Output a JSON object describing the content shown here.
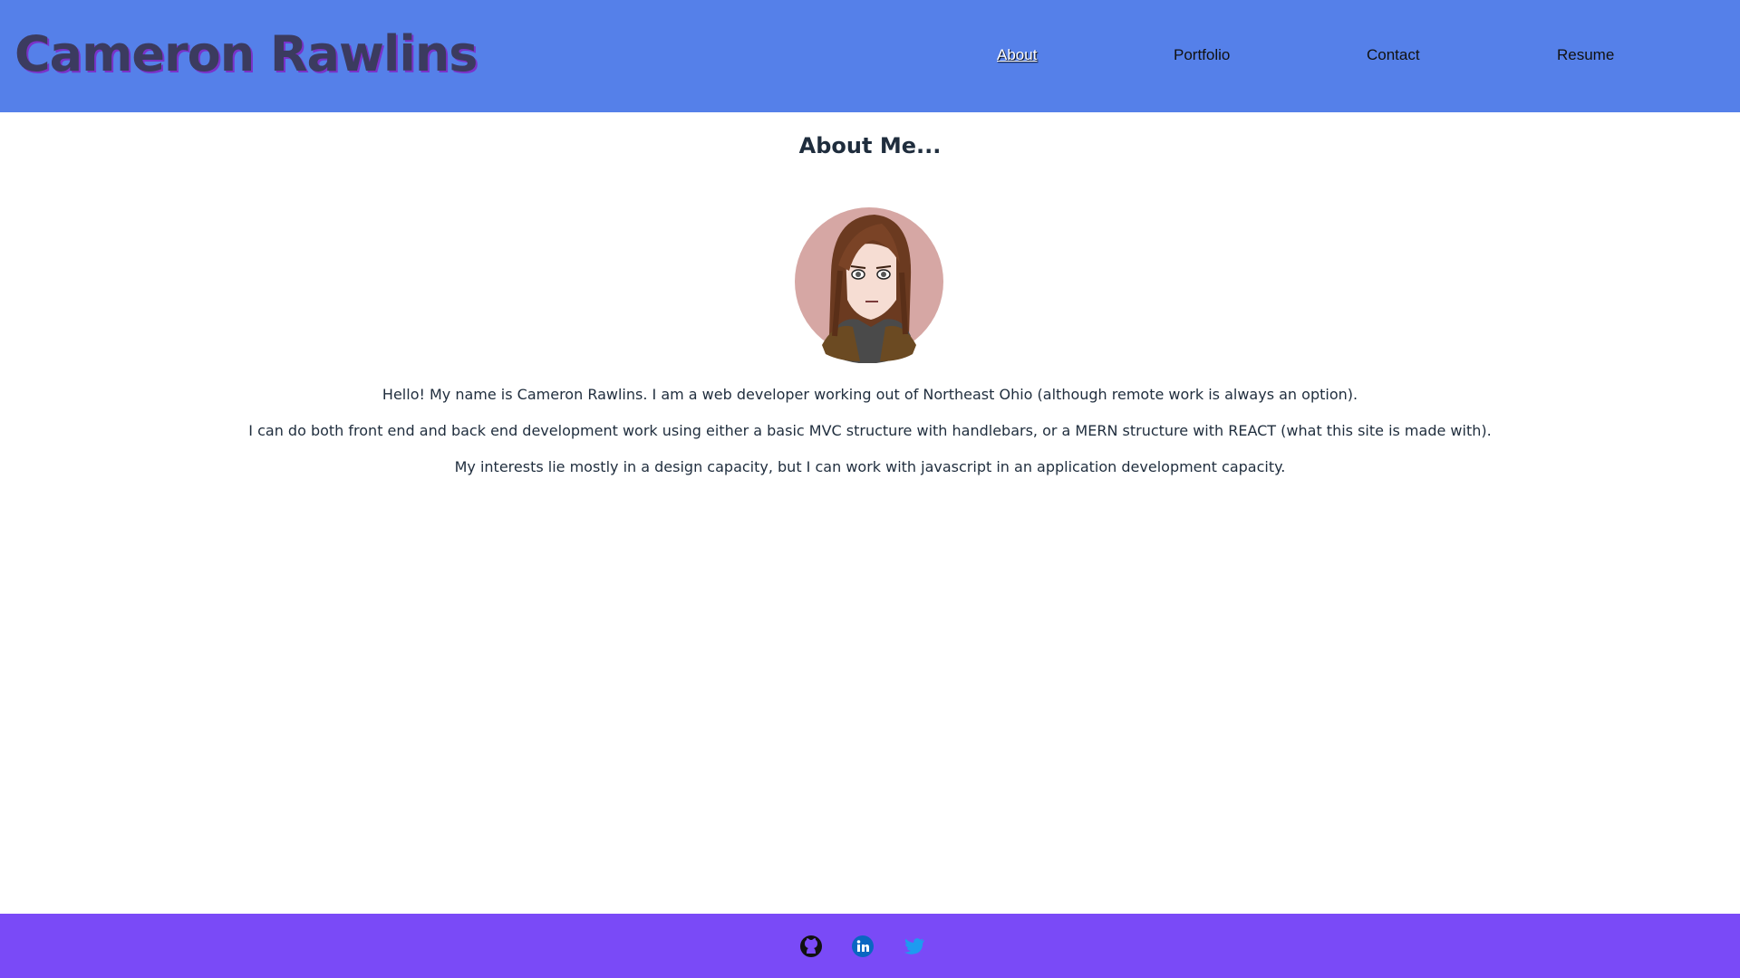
{
  "header": {
    "brand": "Cameron Rawlins",
    "nav": [
      {
        "label": "About",
        "active": true
      },
      {
        "label": "Portfolio",
        "active": false
      },
      {
        "label": "Contact",
        "active": false
      },
      {
        "label": "Resume",
        "active": false
      }
    ],
    "background_color": "#5580e9"
  },
  "main": {
    "title": "About Me...",
    "avatar_icon": "cartoon-portrait",
    "paragraphs": [
      "Hello! My name is Cameron Rawlins. I am a web developer working out of Northeast Ohio (although remote work is always an option).",
      "I can do both front end and back end development work using either a basic MVC structure with handlebars, or a MERN structure with REACT (what this site is made with).",
      "My interests lie mostly in a design capacity, but I can work with javascript in an application development capacity."
    ]
  },
  "footer": {
    "background_color": "#7a4af7",
    "links": [
      {
        "icon": "github-icon"
      },
      {
        "icon": "linkedin-icon"
      },
      {
        "icon": "twitter-icon"
      }
    ]
  }
}
